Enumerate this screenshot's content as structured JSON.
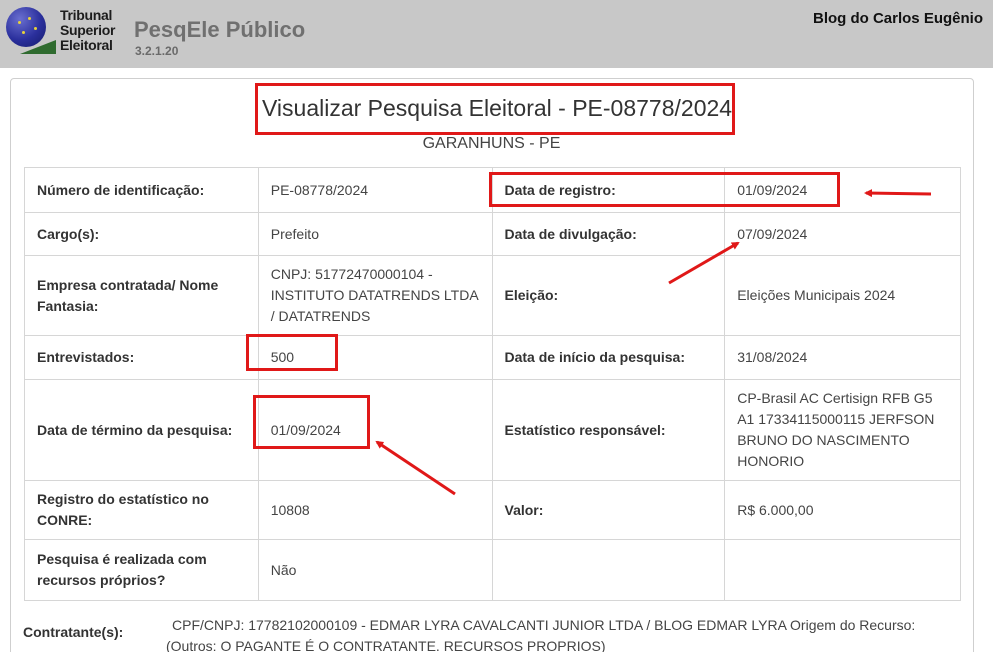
{
  "header": {
    "logo_lines": [
      "Tribunal",
      "Superior",
      "Eleitoral"
    ],
    "app_name": "PesqEle Público",
    "version": "3.2.1.20",
    "watermark": "Blog do Carlos Eugênio"
  },
  "page": {
    "title": "Visualizar Pesquisa Eleitoral - PE-08778/2024",
    "location": "GARANHUNS - PE"
  },
  "fields": {
    "numero_label": "Número de identificação:",
    "numero_value": "PE-08778/2024",
    "data_registro_label": "Data de registro:",
    "data_registro_value": "01/09/2024",
    "cargo_label": "Cargo(s):",
    "cargo_value": "Prefeito",
    "data_divulgacao_label": "Data de divulgação:",
    "data_divulgacao_value": "07/09/2024",
    "empresa_label": "Empresa contratada/ Nome Fantasia:",
    "empresa_value": "CNPJ: 51772470000104 - INSTITUTO DATATRENDS LTDA / DATATRENDS",
    "eleicao_label": "Eleição:",
    "eleicao_value": "Eleições Municipais 2024",
    "entrevistados_label": "Entrevistados:",
    "entrevistados_value": "500",
    "data_inicio_label": "Data de início da pesquisa:",
    "data_inicio_value": "31/08/2024",
    "data_termino_label": "Data de término da pesquisa:",
    "data_termino_value": "01/09/2024",
    "estatistico_label": "Estatístico responsável:",
    "estatistico_value": "CP-Brasil AC Certisign RFB G5 A1 17334115000115 JERFSON BRUNO DO NASCIMENTO HONORIO",
    "registro_conre_label": "Registro do estatístico no CONRE:",
    "registro_conre_value": "10808",
    "valor_label": "Valor:",
    "valor_value": "R$ 6.000,00",
    "recursos_label": "Pesquisa é realizada com recursos próprios?",
    "recursos_value": "Não"
  },
  "contratante": {
    "label": "Contratante(s):",
    "value": "CPF/CNPJ: 17782102000109 - EDMAR LYRA CAVALCANTI JUNIOR LTDA / BLOG EDMAR LYRA Origem do Recurso: (Outros: O PAGANTE É O CONTRATANTE. RECURSOS PROPRIOS)"
  },
  "colors": {
    "header_bg": "#c8c8c8",
    "highlight": "#e01818"
  }
}
